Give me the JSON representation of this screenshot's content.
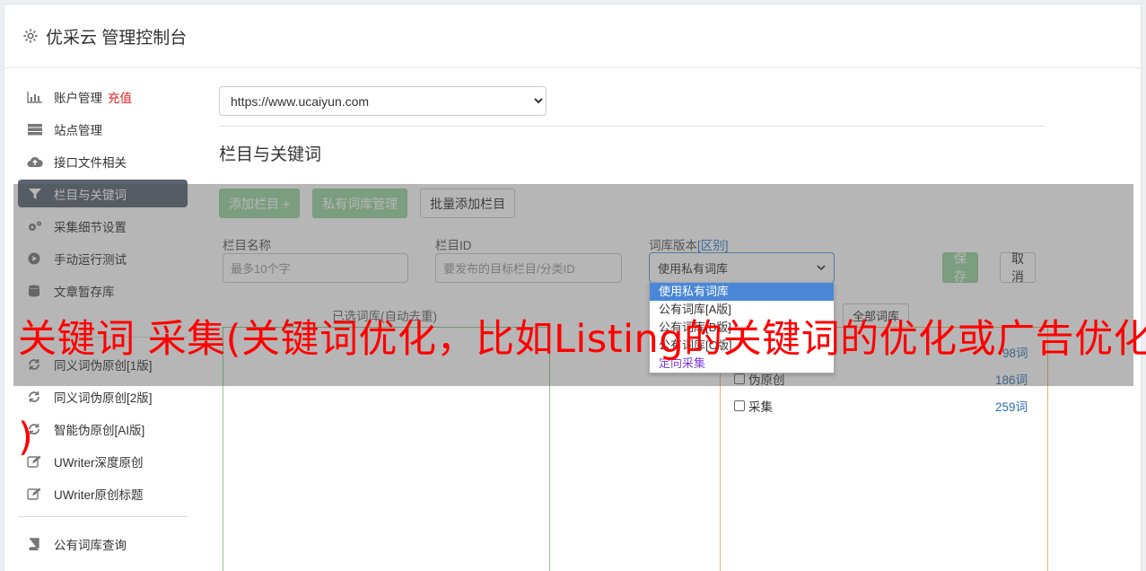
{
  "header": {
    "title": "优采云 管理控制台"
  },
  "sidebar": {
    "items": [
      {
        "label": "账户管理",
        "icon": "bar-chart-icon",
        "extra": "充值"
      },
      {
        "label": "站点管理",
        "icon": "server-icon"
      },
      {
        "label": "接口文件相关",
        "icon": "cloud-upload-icon"
      },
      {
        "label": "栏目与关键词",
        "icon": "filter-icon",
        "active": true
      },
      {
        "label": "采集细节设置",
        "icon": "cogs-icon"
      },
      {
        "label": "手动运行测试",
        "icon": "play-icon"
      },
      {
        "label": "文章暂存库",
        "icon": "database-icon"
      },
      {
        "label": "同义词伪原创[1版]",
        "icon": "refresh-icon"
      },
      {
        "label": "同义词伪原创[2版]",
        "icon": "refresh-icon"
      },
      {
        "label": "智能伪原创[AI版]",
        "icon": "refresh-icon"
      },
      {
        "label": "UWriter深度原创",
        "icon": "edit-icon"
      },
      {
        "label": "UWriter原创标题",
        "icon": "edit-icon"
      },
      {
        "label": "公有词库查询",
        "icon": "book-icon"
      }
    ]
  },
  "main": {
    "site_select": "https://www.ucaiyun.com",
    "section_title": "栏目与关键词",
    "buttons": {
      "add_column": "添加栏目 +",
      "private_lib": "私有词库管理",
      "batch_add": "批量添加栏目"
    },
    "form": {
      "col_name_label": "栏目名称",
      "col_name_placeholder": "最多10个字",
      "col_id_label": "栏目ID",
      "col_id_placeholder": "要发布的目标栏目/分类ID",
      "lib_version_label": "词库版本",
      "lib_version_link": "[区别]",
      "lib_version_value": "使用私有词库",
      "save": "保存",
      "cancel": "取消"
    },
    "dropdown_options": [
      "使用私有词库",
      "公有词库[A版]",
      "公有词库[B版]",
      "公有词库[C版]",
      "定向采集"
    ],
    "selected_label": "已选词库(自动去重)",
    "all_libs": "全部词库",
    "words": [
      {
        "label": "",
        "count": "98词"
      },
      {
        "label": "伪原创",
        "count": "186词"
      },
      {
        "label": "采集",
        "count": "259词"
      }
    ]
  },
  "caption": {
    "line1": "关键词 采集(关键词优化，比如Listing的关键词的优化或广告优化",
    "line2": ")"
  },
  "colors": {
    "active_nav": "#5b6470",
    "green_button": "#9cd6a2",
    "caption": "#ff0000"
  }
}
